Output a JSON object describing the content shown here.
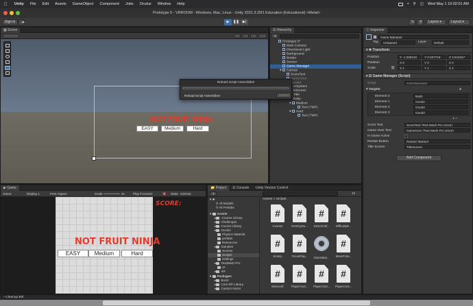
{
  "menubar": {
    "app_name": "Unity",
    "items": [
      "File",
      "Edit",
      "Assets",
      "GameObject",
      "Component",
      "Jobs",
      "Oculus",
      "Window",
      "Help"
    ],
    "clock": "Wed May 1  10:02:01 AM"
  },
  "window": {
    "title": "Prototype 5 - VRROOM - Windows, Mac, Linux - Unity 2021.3.25f1 Education (Educational) <Metal>"
  },
  "toolbar": {
    "sign_in": "Sign in",
    "layers": "Layers",
    "layout": "Layout"
  },
  "scene_panel": {
    "tab": "Scene",
    "game_title": "NOT FRUIT NINJA",
    "buttons": [
      "EASY",
      "Medium",
      "Hard"
    ]
  },
  "hierarchy": {
    "tab": "Hierarchy",
    "items": [
      "Prototype 5*",
      "Main Camera",
      "Directional Light",
      "Background",
      "Border",
      "Sensor",
      "Game Manager",
      "Canvas",
      "ScoreText",
      "GameOver",
      "Restart",
      "erSystem",
      "leScreen",
      "Title",
      "Easy",
      "Medium",
      "Text (TMP)",
      "Hard",
      "Text (TMP)"
    ]
  },
  "dialog": {
    "title": "Reload Script Assemblies",
    "message": "Reload Script Assemblies",
    "cancel": "Cancel"
  },
  "inspector": {
    "tab": "Inspector",
    "object_name": "Game Manager",
    "tag_label": "Tag",
    "tag_value": "Untagged",
    "layer_label": "Layer",
    "layer_value": "Default",
    "transform_title": "Transform",
    "position_label": "Position",
    "rotation_label": "Rotation",
    "scale_label": "Scale",
    "position": [
      "X -1.036315",
      "Y 0.037718",
      "Z 2.510447"
    ],
    "rotation": [
      "X 0",
      "Y 0",
      "Z 0"
    ],
    "scale": [
      "X 1",
      "Y 1",
      "Z 1"
    ],
    "script_title": "Game Manager (Script)",
    "script_label": "Script",
    "script_value": "GameManager",
    "targets_label": "Targets",
    "targets_count": "4",
    "elements": [
      {
        "label": "Element 0",
        "value": "Bad1"
      },
      {
        "label": "Element 1",
        "value": "Good1"
      },
      {
        "label": "Element 2",
        "value": "Good2"
      },
      {
        "label": "Element 3",
        "value": "Good3"
      }
    ],
    "fields": [
      {
        "label": "Score Text",
        "value": "ScoreText (Text Mesh Pro UGUI)"
      },
      {
        "label": "Game Over Text",
        "value": "GameOver (Text Mesh Pro UGUI)"
      },
      {
        "label": "Is Game Active",
        "value": ""
      },
      {
        "label": "Restart Button",
        "value": "Restart (Button)"
      },
      {
        "label": "Title Screen",
        "value": "TitleScreen"
      }
    ],
    "add_component": "Add Component"
  },
  "game_panel": {
    "tab": "Game",
    "display": "Game",
    "display_num": "Display 1",
    "aspect": "Free Aspect",
    "scale_label": "Scale",
    "scale_value": "2x",
    "play_focused": "Play Focused",
    "stats": "Stats",
    "gizmos": "Gizmos",
    "score_label": "SCORE:",
    "game_title": "NOT FRUIT NINJA",
    "buttons": [
      "EASY",
      "Medium",
      "Hard"
    ]
  },
  "project_panel": {
    "tabs": [
      "Project",
      "Console",
      "Unity Version Control"
    ],
    "favorites": [
      "All Models",
      "All Prefabs"
    ],
    "assets_label": "Assets",
    "folders": [
      ".Course Library",
      "Challenges",
      "Course Library",
      "Oculus",
      "Physics Material",
      "prefabs",
      "Resources",
      "Samples",
      "Scenes",
      "Scripts",
      "Settings",
      "TextMesh Pro",
      "UI",
      "XR"
    ],
    "packages_label": "Packages",
    "packages": [
      "Burst",
      "Core RP Library",
      "Custom NUnit"
    ],
    "breadcrumb": "Assets > Scripts",
    "asset_count": "12",
    "assets": [
      "Counter",
      "DestroyOu...",
      "DetectColl...",
      "DifficultyB...",
      "Enemy",
      "FocusPlay...",
      "GameMan...",
      "MoveForw...",
      "MoveLeft",
      "PlayerCont...",
      "PlayerCont...",
      "PlayerCont..."
    ]
  },
  "status_bar": {
    "text": "Cleanup Bilt"
  },
  "colors": {
    "accent": "#2f5f94",
    "title_red": "#e83a2a"
  }
}
